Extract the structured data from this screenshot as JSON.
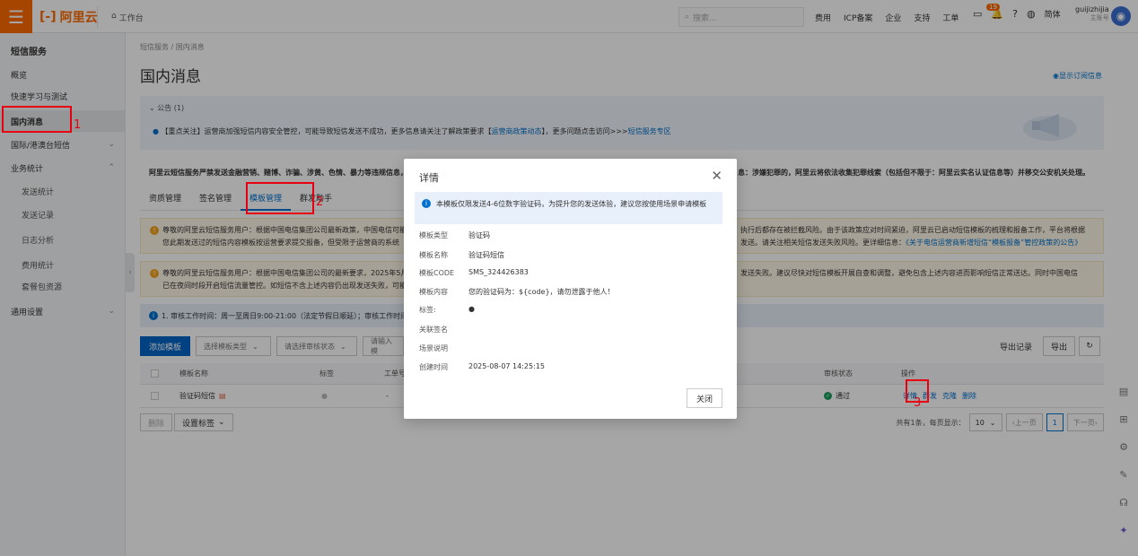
{
  "topbar": {
    "brand": "阿里云",
    "workbench": "工作台",
    "search_placeholder": "搜索...",
    "nav": [
      "费用",
      "ICP备案",
      "企业",
      "支持",
      "工单"
    ],
    "notify_count": "19",
    "lang": "简体",
    "account_name": "guijizhijia",
    "account_type": "主账号"
  },
  "sidebar": {
    "title": "短信服务",
    "items": [
      {
        "label": "概览"
      },
      {
        "label": "快速学习与测试"
      },
      {
        "label": "国内消息"
      },
      {
        "label": "国际/港澳台短信"
      },
      {
        "label": "业务统计"
      },
      {
        "label": "发送统计"
      },
      {
        "label": "发送记录"
      },
      {
        "label": "日志分析"
      },
      {
        "label": "费用统计"
      },
      {
        "label": "套餐包资源"
      },
      {
        "label": "通用设置"
      }
    ]
  },
  "main": {
    "breadcrumb": "短信服务 / 国内消息",
    "title": "国内消息",
    "show_sub": "显示订阅信息",
    "notice_head": "公告 (1)",
    "notice_text": "【重点关注】运营商加强短信内容安全管控，可能导致短信发送不成功，更多信息请关注了解政策要求【",
    "notice_link1": "运营商政策动态",
    "notice_text2": "】，更多问题点击访问>>>",
    "notice_link2": "短信服务专区",
    "warn_left": "阿里云短信服务严禁发送金融营销、赌博、诈骗、涉黄、色情、暴力等违规信息，",
    "warn_right": "息：涉嫌犯罪的，阿里云将依法收集犯罪线索（包括但不限于：阿里云实名认证信息等）并移交公安机关处理。",
    "tabs": [
      "资质管理",
      "签名管理",
      "模板管理",
      "群发助手"
    ],
    "yellow1_left1": "尊敬的阿里云短信服务用户：根据中国电信集团公司最新政策，中国电信可能",
    "yellow1_left2": "您此期发送过的短信内容模板按运营要求提交报备，但受限于运营商的系统",
    "yellow1_right1": "执行后都存在被拦截风险。由于该政策应对时间紧迫，阿里云已启动短信模板的梳理和报备工作，平台将根据",
    "yellow1_right2": "发送。请关注相关短信发送失败风险。更详细信息：",
    "yellow1_link": "《关于电信运营商新增短信“模板报备”管控政策的公告》",
    "yellow2_left1": "尊敬的阿里云短信服务用户：根据中国电信集团公司的最新要求，2025年5月",
    "yellow2_left2": "已在夜间时段开启短信流量管控。如短信不含上述内容仍出现发送失败，可能",
    "yellow2_right1": "发送失败。建议尽快对短信模板开展自查和调整，避免包含上述内容进而影响短信正常送达。同时中国电信",
    "info_text": "1. 审核工作时间：周一至周日9:00-21:00（法定节假日顺延）；审核工作时间",
    "add_template": "添加模板",
    "select_type": "选择模板类型",
    "select_status": "请选择审核状态",
    "input_placeholder": "请输入模",
    "export_records": "导出记录",
    "export": "导出",
    "columns": [
      "模板名称",
      "标签",
      "工单号",
      "审核状态",
      "操作"
    ],
    "row": {
      "name": "验证码短信",
      "tag": "",
      "ticket": "-",
      "status": "通过",
      "ops": [
        "详情",
        "群发",
        "克隆",
        "删除"
      ]
    },
    "delete": "删除",
    "set_tag": "设置标签",
    "pager_total": "共有1条，每页显示：",
    "page_size": "10",
    "prev": "上一页",
    "page": "1",
    "next": "下一页"
  },
  "dialog": {
    "title": "详情",
    "info": "本模板仅限发送4-6位数字验证码，为提升您的发送体验，建议您按使用场景申请模板",
    "fields": [
      {
        "k": "模板类型",
        "v": "验证码"
      },
      {
        "k": "模板名称",
        "v": "验证码短信"
      },
      {
        "k": "模板CODE",
        "v": "SMS_324426383"
      },
      {
        "k": "模板内容",
        "v": "您的验证码为：${code}，请勿泄露于他人！"
      },
      {
        "k": "标签:",
        "v": ""
      },
      {
        "k": "关联签名",
        "v": ""
      },
      {
        "k": "场景说明",
        "v": ""
      },
      {
        "k": "创建时间",
        "v": "2025-08-07 14:25:15"
      }
    ],
    "close_btn": "关闭"
  },
  "annotations": [
    "1",
    "2",
    "3"
  ],
  "colors": {
    "accent": "#ff6a00",
    "link": "#0070cc",
    "highlight": "#e60012"
  }
}
